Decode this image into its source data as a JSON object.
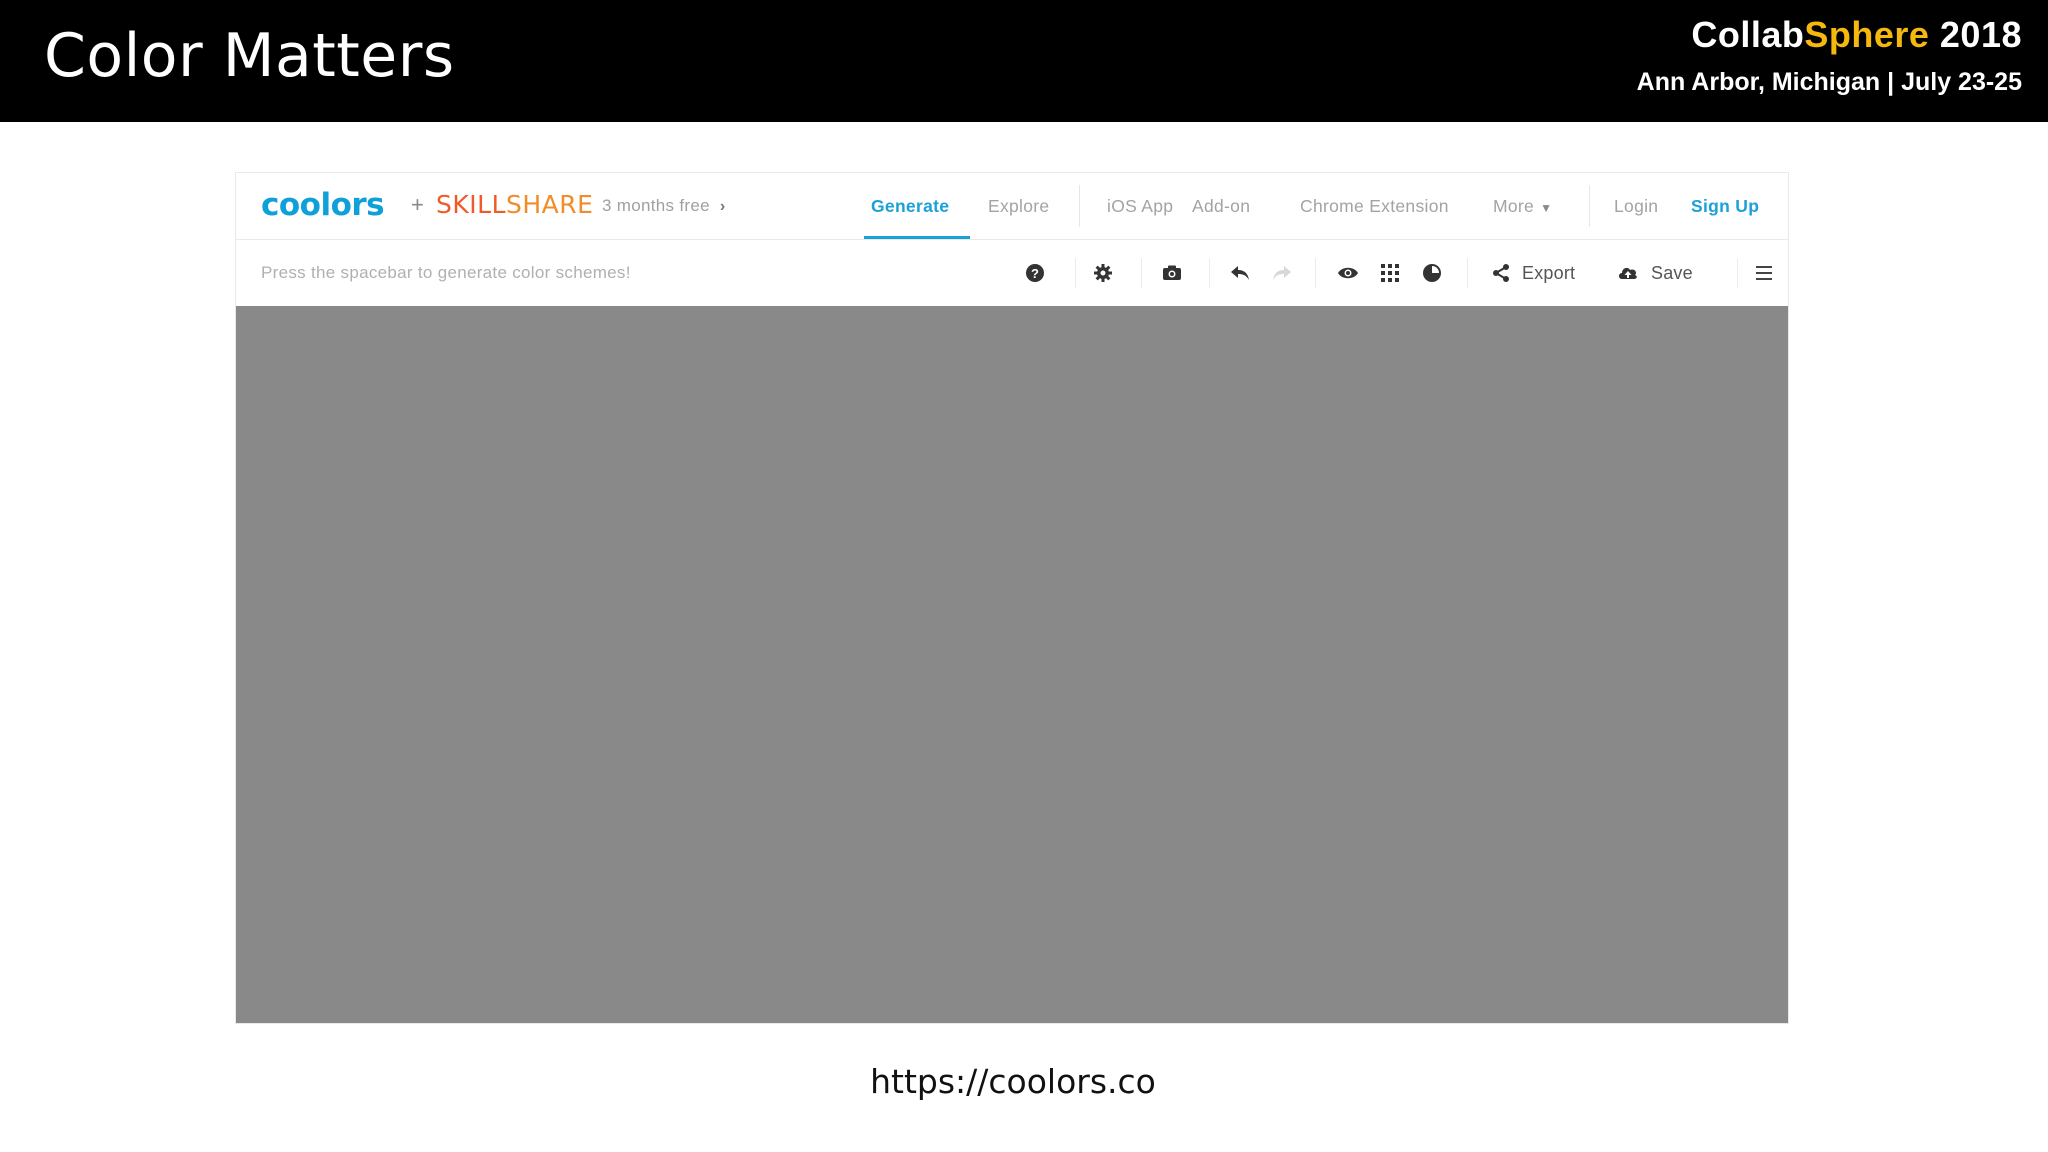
{
  "slide": {
    "title": "Color Matters",
    "conference": {
      "name_part1": "Collab",
      "name_part2": "Sphere",
      "year": "2018",
      "subtitle": "Ann Arbor, Michigan | July 23-25",
      "accent_color": "#f5b90e"
    },
    "caption": "https://coolors.co"
  },
  "app": {
    "logo": "coolors",
    "partner_plus": "+",
    "partner_part1": "SKILL",
    "partner_part2": "SHARE",
    "promo": "3 months free",
    "nav": {
      "generate": "Generate",
      "explore": "Explore",
      "ios_app": "iOS App",
      "addon": "Add-on",
      "chrome_extension": "Chrome Extension",
      "more": "More",
      "login": "Login",
      "signup": "Sign Up"
    },
    "toolbar": {
      "hint": "Press the spacebar to generate color schemes!",
      "export": "Export",
      "save": "Save"
    },
    "swatch_color": "#898989",
    "brand_color": "#1ba0d8"
  }
}
